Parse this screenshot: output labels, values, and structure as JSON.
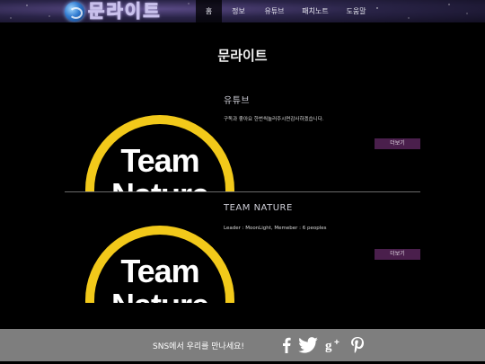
{
  "header": {
    "logo_text": "문라이트",
    "logo_icon": "globe-icon",
    "nav": [
      {
        "label": "홈",
        "active": true
      },
      {
        "label": "정보",
        "active": false
      },
      {
        "label": "유튜브",
        "active": false
      },
      {
        "label": "패치노트",
        "active": false
      },
      {
        "label": "도움말",
        "active": false
      }
    ]
  },
  "page": {
    "title": "문라이트"
  },
  "sections": [
    {
      "title": "유튜브",
      "description": "구독과 좋아요 한번씩눌러주시면감사하겠습니다.",
      "button_label": "더보기",
      "logo_line1": "Team",
      "logo_line2": "Nature"
    },
    {
      "title": "TEAM NATURE",
      "description": "Leader : MoonLight, Memeber : 6 peoples",
      "button_label": "더보기",
      "logo_line1": "Team",
      "logo_line2": "Nature"
    }
  ],
  "footer": {
    "text": "SNS에서 우리를 만나세요!",
    "social_icons": [
      "facebook-icon",
      "twitter-icon",
      "google-plus-icon",
      "pinterest-icon"
    ]
  },
  "colors": {
    "accent_button": "#4a1f4c",
    "logo_ring": "#f2c91a",
    "footer_bg": "#7e7e7e"
  }
}
